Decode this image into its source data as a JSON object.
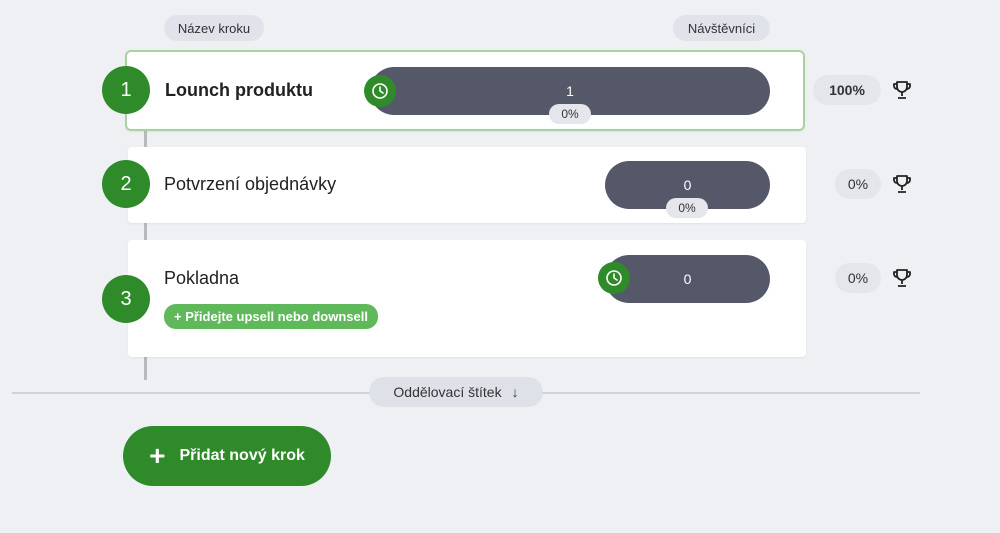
{
  "header": {
    "step_name_label": "Název kroku",
    "visitors_label": "Návštěvníci"
  },
  "steps": [
    {
      "number": "1",
      "name": "Lounch produktu",
      "visitors": "1",
      "drop_pct": "0%",
      "conversion": "100%",
      "active": true,
      "has_timer": true
    },
    {
      "number": "2",
      "name": "Potvrzení objednávky",
      "visitors": "0",
      "drop_pct": "0%",
      "conversion": "0%",
      "active": false,
      "has_timer": false
    },
    {
      "number": "3",
      "name": "Pokladna",
      "visitors": "0",
      "conversion": "0%",
      "active": false,
      "has_timer": true,
      "upsell_label": "+ Přidejte upsell nebo downsell"
    }
  ],
  "divider": {
    "label": "Oddělovací štítek",
    "arrow": "↓"
  },
  "add_step": {
    "icon": "+",
    "label": "Přidat nový krok"
  },
  "icons": {
    "timer": "clock-icon",
    "trophy": "trophy-icon",
    "add": "plus-icon",
    "arrow": "arrow-down-icon"
  },
  "colors": {
    "primary_green": "#2f8a2a",
    "bar": "#545869",
    "upsell": "#5fb85a",
    "active_border": "#a8d3a0"
  }
}
